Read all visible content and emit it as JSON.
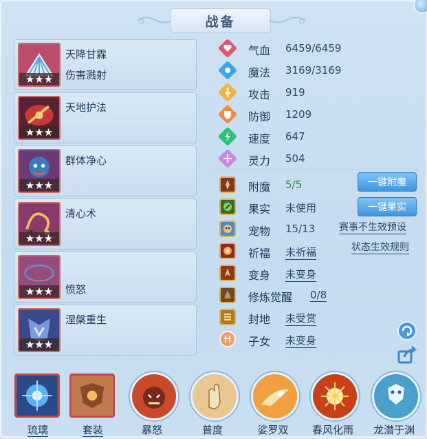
{
  "title": "战备",
  "skills": [
    {
      "name": "天降甘霖",
      "sub": "伤害溅射",
      "stars": "★★★"
    },
    {
      "name": "天地护法",
      "sub": "",
      "stars": "★★★"
    },
    {
      "name": "群体净心",
      "sub": "",
      "stars": "★★★"
    },
    {
      "name": "清心术",
      "sub": "",
      "stars": "★★★"
    },
    {
      "name": "",
      "sub": "愤怒",
      "stars": "★★★"
    },
    {
      "name": "涅槃重生",
      "sub": "",
      "stars": "★★★"
    }
  ],
  "stats": [
    {
      "label": "气血",
      "value": "6459/6459",
      "icon": "heart-icon",
      "color": "#e0566a"
    },
    {
      "label": "魔法",
      "value": "3169/3169",
      "icon": "mana-icon",
      "color": "#3aa6ee"
    },
    {
      "label": "攻击",
      "value": "919",
      "icon": "sword-icon",
      "color": "#f0b240"
    },
    {
      "label": "防御",
      "value": "1209",
      "icon": "shield-icon",
      "color": "#f08a40"
    },
    {
      "label": "速度",
      "value": "647",
      "icon": "speed-icon",
      "color": "#2cc07a"
    },
    {
      "label": "灵力",
      "value": "504",
      "icon": "spirit-icon",
      "color": "#c98ae0"
    }
  ],
  "extras": [
    {
      "label": "附魔",
      "value": "5/5",
      "icon": "enchant-icon"
    },
    {
      "label": "果实",
      "value": "未使用",
      "icon": "fruit-icon"
    },
    {
      "label": "宠物",
      "value": "15/13",
      "icon": "pet-icon"
    },
    {
      "label": "祈福",
      "value": "未祈福",
      "icon": "bless-icon"
    },
    {
      "label": "变身",
      "value": "未变身",
      "icon": "transform-icon"
    },
    {
      "label": "修炼觉醒",
      "value": "0/8",
      "icon": "cultivation-icon"
    },
    {
      "label": "封地",
      "value": "未受赏",
      "icon": "fief-icon"
    },
    {
      "label": "子女",
      "value": "未变身",
      "icon": "child-icon"
    }
  ],
  "buttons": {
    "enchant": "一键附魔",
    "fruit": "一键果实"
  },
  "links": {
    "event_rule": "赛事不生效预设",
    "status_rule": "状态生效规则"
  },
  "bottom": [
    {
      "label": "琉璃",
      "kind": "square",
      "icon": "glass-orb-icon"
    },
    {
      "label": "套装",
      "kind": "square",
      "icon": "armor-set-icon"
    },
    {
      "label": "暴怒",
      "kind": "circle",
      "icon": "rage-beast-icon"
    },
    {
      "label": "普度",
      "kind": "circle",
      "icon": "prayer-hand-icon"
    },
    {
      "label": "娑罗双",
      "kind": "circle",
      "icon": "sala-icon"
    },
    {
      "label": "春风化雨",
      "kind": "circle",
      "icon": "spring-rain-icon"
    },
    {
      "label": "龙潜于渊",
      "kind": "circle",
      "icon": "dragon-icon"
    }
  ]
}
